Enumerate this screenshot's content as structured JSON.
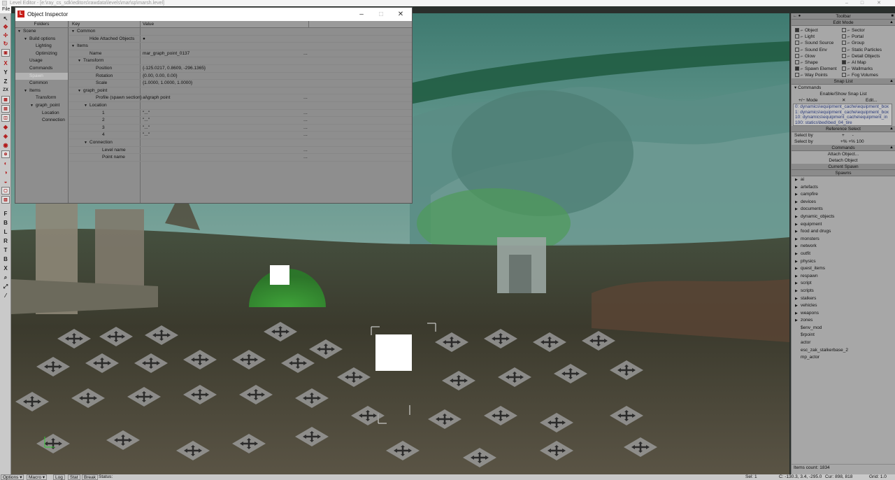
{
  "window": {
    "title": "Level Editor - [e:\\ray_cs_sdk\\editors\\rawdata\\levels\\mar\\sp\\marsh.level]",
    "menu_file": "File"
  },
  "left_toolbar": {
    "glyphs": [
      "X",
      "Y",
      "Z",
      "ZX",
      "F",
      "B",
      "L",
      "R",
      "T",
      "B",
      "X"
    ]
  },
  "inspector": {
    "title": "Object Inspector",
    "folders_header": "Folders",
    "folders": [
      {
        "label": "Scene",
        "indent": 0,
        "arrow": "▼"
      },
      {
        "label": "Build options",
        "indent": 1,
        "arrow": "▼"
      },
      {
        "label": "Lighting",
        "indent": 2,
        "arrow": ""
      },
      {
        "label": "Optimizing",
        "indent": 2,
        "arrow": ""
      },
      {
        "label": "Usage",
        "indent": 1,
        "arrow": ""
      },
      {
        "label": "Commands",
        "indent": 1,
        "arrow": ""
      },
      {
        "label": "Spawn",
        "indent": 1,
        "arrow": "",
        "selected": true
      },
      {
        "label": "Common",
        "indent": 1,
        "arrow": ""
      },
      {
        "label": "Items",
        "indent": 1,
        "arrow": "▼"
      },
      {
        "label": "Transform",
        "indent": 2,
        "arrow": ""
      },
      {
        "label": "graph_point",
        "indent": 2,
        "arrow": "▼"
      },
      {
        "label": "Location",
        "indent": 3,
        "arrow": ""
      },
      {
        "label": "Connection",
        "indent": 3,
        "arrow": ""
      }
    ],
    "key_header": "Key",
    "value_header": "Value",
    "properties": [
      {
        "key": "Common",
        "indent": 0,
        "arrow": "▼",
        "value": "",
        "dots": ""
      },
      {
        "key": "Hide Attached Objects",
        "indent": 2,
        "arrow": "",
        "value": "●",
        "dots": ""
      },
      {
        "key": "Items",
        "indent": 0,
        "arrow": "▼",
        "value": "",
        "dots": ""
      },
      {
        "key": "Name",
        "indent": 2,
        "arrow": "",
        "value": "mar_graph_point_0137",
        "dots": "..."
      },
      {
        "key": "Transform",
        "indent": 1,
        "arrow": "▼",
        "value": "",
        "dots": ""
      },
      {
        "key": "Position",
        "indent": 3,
        "arrow": "",
        "value": "{-125.0217, 0.8609, -296.1365}",
        "dots": ""
      },
      {
        "key": "Rotation",
        "indent": 3,
        "arrow": "",
        "value": "{0.00, 0.00, 0.00}",
        "dots": ""
      },
      {
        "key": "Scale",
        "indent": 3,
        "arrow": "",
        "value": "{1.0000, 1.0000, 1.0000}",
        "dots": ""
      },
      {
        "key": "graph_point",
        "indent": 1,
        "arrow": "▼",
        "value": "",
        "dots": ""
      },
      {
        "key": "Profile (spawn section)",
        "indent": 3,
        "arrow": "",
        "value": "ai\\graph point",
        "dots": "..."
      },
      {
        "key": "Location",
        "indent": 2,
        "arrow": "▼",
        "value": "",
        "dots": ""
      },
      {
        "key": "1",
        "indent": 4,
        "arrow": "",
        "value": "\"...\"",
        "dots": "..."
      },
      {
        "key": "2",
        "indent": 4,
        "arrow": "",
        "value": "\"...\"",
        "dots": "..."
      },
      {
        "key": "3",
        "indent": 4,
        "arrow": "",
        "value": "\"...\"",
        "dots": "..."
      },
      {
        "key": "4",
        "indent": 4,
        "arrow": "",
        "value": "\"...\"",
        "dots": "..."
      },
      {
        "key": "Connection",
        "indent": 2,
        "arrow": "▼",
        "value": "",
        "dots": ""
      },
      {
        "key": "Level name",
        "indent": 4,
        "arrow": "",
        "value": "",
        "dots": "..."
      },
      {
        "key": "Point name",
        "indent": 4,
        "arrow": "",
        "value": "",
        "dots": "..."
      }
    ]
  },
  "right_panel": {
    "toolbar_label": "Toolbar",
    "edit_mode_label": "Edit Mode",
    "edit_mode_left": [
      {
        "label": "Object",
        "checked": true
      },
      {
        "label": "Light",
        "checked": false
      },
      {
        "label": "Sound Source",
        "checked": false
      },
      {
        "label": "Sound Env",
        "checked": false
      },
      {
        "label": "Glow",
        "checked": false
      },
      {
        "label": "Shape",
        "checked": false
      },
      {
        "label": "Spawn Element",
        "checked": true
      },
      {
        "label": "Way Points",
        "checked": false
      }
    ],
    "edit_mode_right": [
      {
        "label": "Sector",
        "checked": false
      },
      {
        "label": "Portal",
        "checked": false
      },
      {
        "label": "Group",
        "checked": false
      },
      {
        "label": "Static Particles",
        "checked": false
      },
      {
        "label": "Detail Objects",
        "checked": false
      },
      {
        "label": "AI Map",
        "checked": true
      },
      {
        "label": "Wallmarks",
        "checked": false
      },
      {
        "label": "Fog Volumes",
        "checked": false
      }
    ],
    "snap_list_label": "Snap List",
    "commands_label": "Commands",
    "enable_snap": "Enable/Show Snap List",
    "mode_label": "Mode",
    "edit_label": "Edit...",
    "snap_items": [
      "0: dynamics\\equipment_cache\\equipment_box",
      "1: dynamics\\equipment_cache\\equipment_box",
      "10: dynamics\\equipment_cache\\equipment_in",
      "100: statics\\bed\\bed_04_tire"
    ],
    "reference_select_label": "Reference Select",
    "select_by_1": "Select by",
    "select_by_2": "Select by",
    "select_by_values": "+%  +%  100",
    "commands2_label": "Commands",
    "attach_object": "Attach Object...",
    "detach_object": "Detach Object",
    "current_spawn_label": "Current Spawn",
    "spawns_label": "Spawns",
    "spawns": [
      {
        "label": "ai",
        "arrow": true
      },
      {
        "label": "artefacts",
        "arrow": true
      },
      {
        "label": "campfire",
        "arrow": true
      },
      {
        "label": "devices",
        "arrow": true
      },
      {
        "label": "documents",
        "arrow": true
      },
      {
        "label": "dynamic_objects",
        "arrow": true
      },
      {
        "label": "equipment",
        "arrow": true
      },
      {
        "label": "food and drugs",
        "arrow": true
      },
      {
        "label": "monsters",
        "arrow": true
      },
      {
        "label": "network",
        "arrow": true
      },
      {
        "label": "outfit",
        "arrow": true
      },
      {
        "label": "physics",
        "arrow": true
      },
      {
        "label": "quest_items",
        "arrow": true
      },
      {
        "label": "respawn",
        "arrow": true
      },
      {
        "label": "script",
        "arrow": true
      },
      {
        "label": "scripts",
        "arrow": true
      },
      {
        "label": "stalkers",
        "arrow": true
      },
      {
        "label": "vehicles",
        "arrow": true
      },
      {
        "label": "weapons",
        "arrow": true
      },
      {
        "label": "zones",
        "arrow": true
      },
      {
        "label": "$env_mod",
        "arrow": false
      },
      {
        "label": "$rpoint",
        "arrow": false
      },
      {
        "label": "actor",
        "arrow": false
      },
      {
        "label": "esc_zak_stalkerbase_2",
        "arrow": false
      },
      {
        "label": "mp_actor",
        "arrow": false
      }
    ],
    "items_count": "Items count: 1834"
  },
  "statusbar": {
    "options": "Options",
    "macro": "Macro",
    "log": "Log",
    "stat": "Stat",
    "break": "Break",
    "status": "Status:",
    "sel": "Sel: 1",
    "coords": "C: -130.3, 3.4, -295.0",
    "cur": "Cur: 898, 818",
    "grid": "Grid: 1.0"
  }
}
